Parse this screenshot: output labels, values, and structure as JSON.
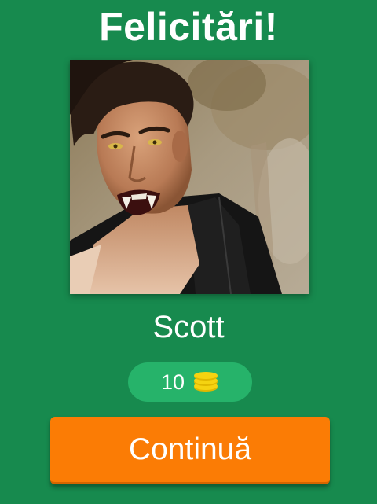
{
  "header": {
    "title": "Felicitări!"
  },
  "image": {
    "subject": "character-portrait"
  },
  "answer": {
    "name": "Scott"
  },
  "reward": {
    "amount": "10",
    "icon": "coins-icon"
  },
  "actions": {
    "continue_label": "Continuă"
  },
  "colors": {
    "background": "#178a4e",
    "reward_pill": "#26b36a",
    "button": "#fb7c05",
    "coin": "#f5d311"
  }
}
